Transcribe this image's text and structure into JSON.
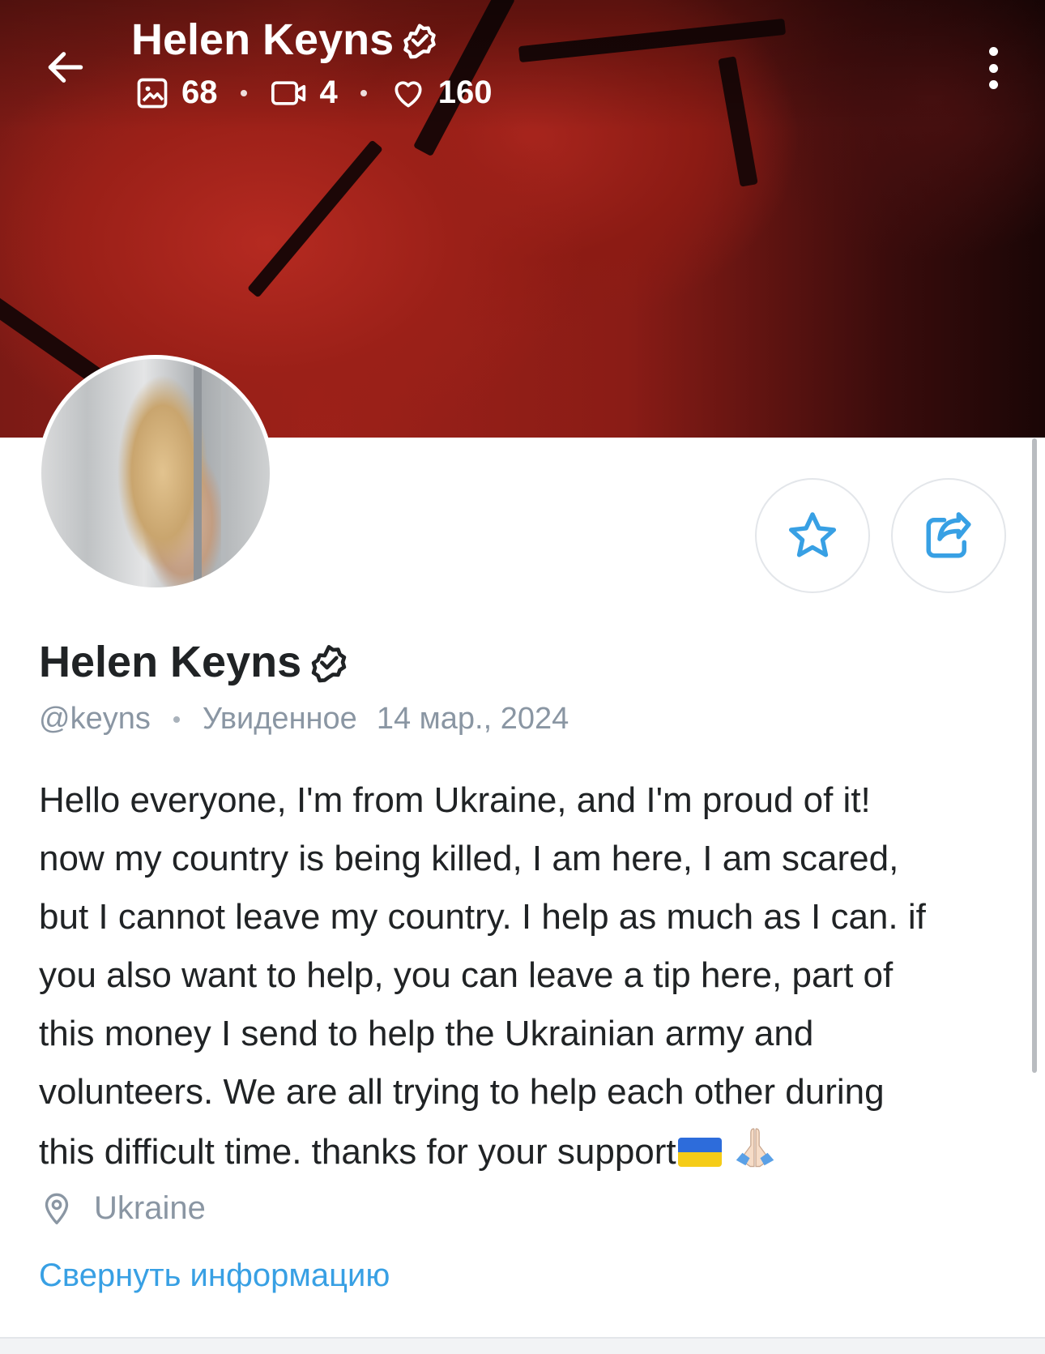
{
  "header": {
    "title": "Helen Keyns",
    "stats": {
      "photos": "68",
      "videos": "4",
      "likes": "160"
    }
  },
  "profile": {
    "name": "Helen Keyns",
    "username": "@keyns",
    "last_seen_label": "Увиденное",
    "last_seen_date": "14 мар., 2024",
    "bio_lines": [
      "Hello everyone, I'm from Ukraine, and I'm proud of it!",
      "now my country is being killed, I am here, I am scared,",
      "but I cannot leave my country. I help as much as I can. if",
      "you also want to help, you can leave a tip here, part of",
      "this money I send to help the Ukrainian army and",
      "volunteers. We are all trying to help each other during",
      "this difficult time. thanks for your support"
    ],
    "location": "Ukraine",
    "collapse_label": "Свернуть информацию"
  },
  "icons": {
    "back": "arrow-left-icon",
    "verified": "verified-badge-icon",
    "photos": "image-icon",
    "videos": "video-camera-icon",
    "likes": "heart-icon",
    "menu": "more-vertical-icon",
    "favorite": "star-icon",
    "share": "share-icon",
    "location": "map-pin-icon"
  },
  "colors": {
    "accent": "#38a0e4",
    "text": "#202325",
    "muted": "#8a96a3",
    "banner": "#9d2119"
  }
}
